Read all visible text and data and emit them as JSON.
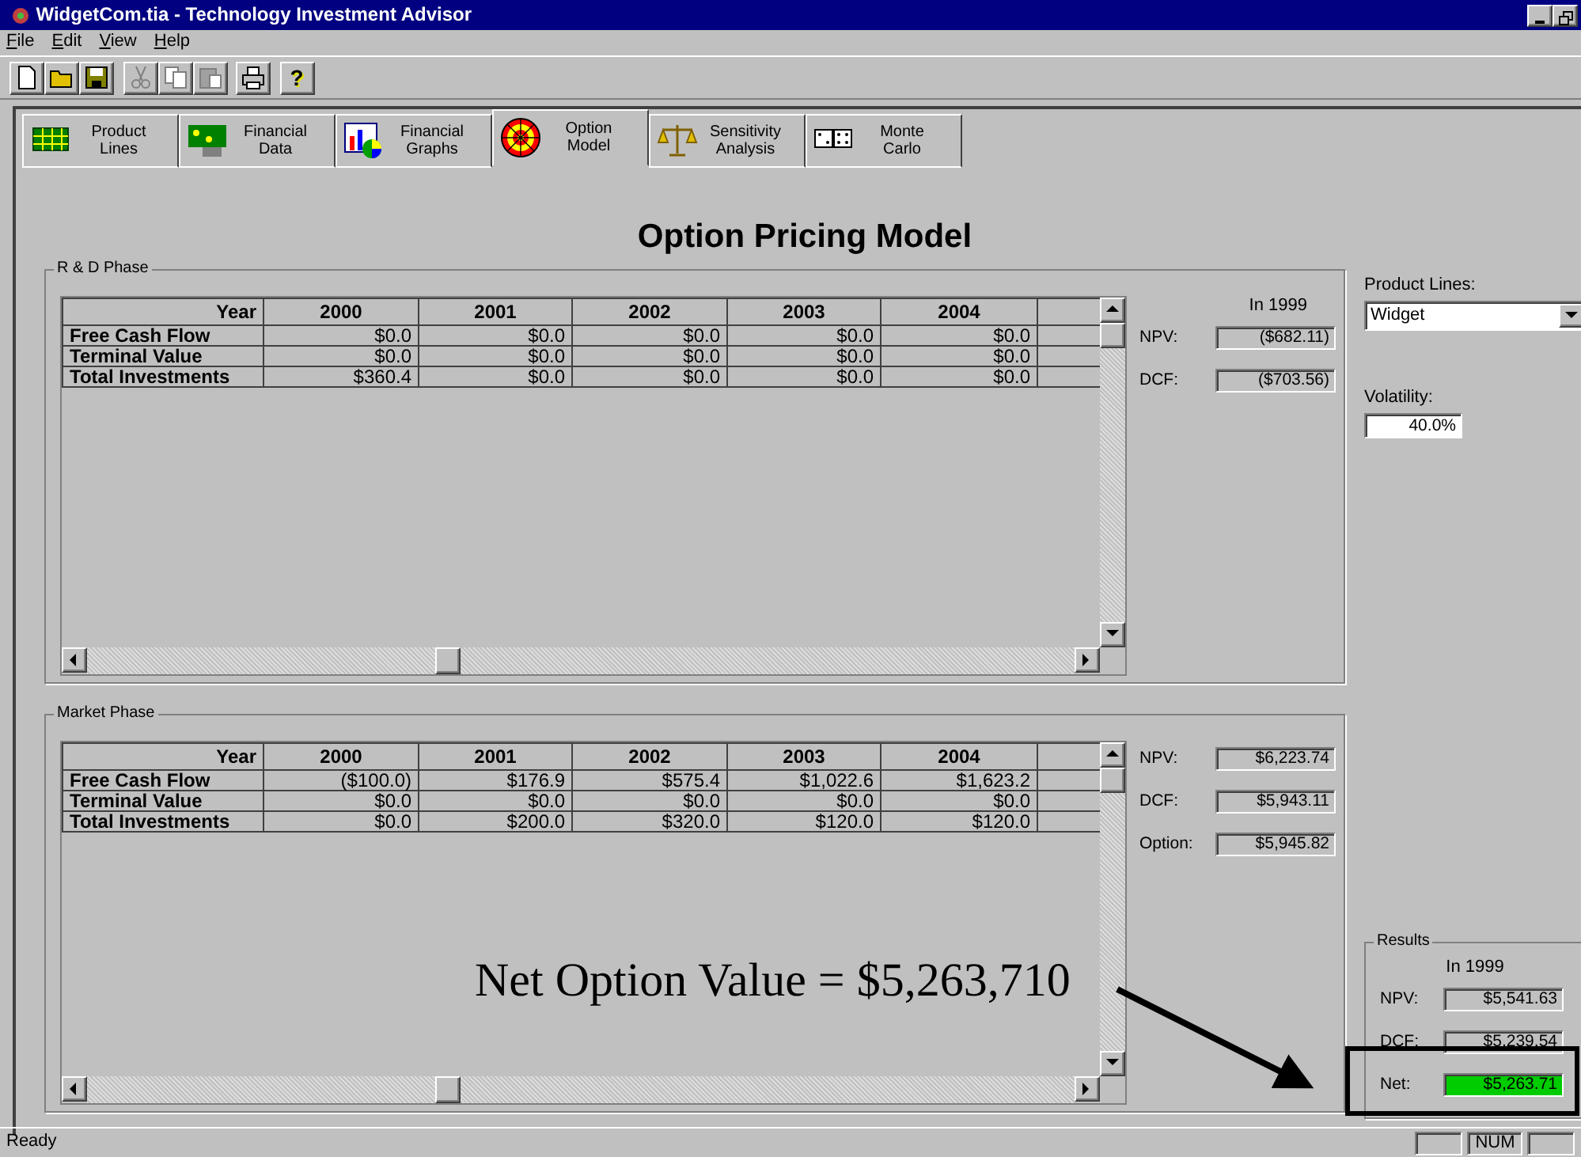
{
  "window": {
    "title": "WidgetCom.tia - Technology Investment Advisor"
  },
  "menu": [
    {
      "label": "File"
    },
    {
      "label": "Edit"
    },
    {
      "label": "View"
    },
    {
      "label": "Help"
    }
  ],
  "toolbar": [
    {
      "kind": "new",
      "disabled": false
    },
    {
      "kind": "open",
      "disabled": false
    },
    {
      "kind": "save",
      "disabled": false
    },
    {
      "kind": "cut",
      "disabled": true
    },
    {
      "kind": "copy",
      "disabled": true
    },
    {
      "kind": "paste",
      "disabled": true
    },
    {
      "kind": "print",
      "disabled": false
    },
    {
      "kind": "help",
      "disabled": false,
      "glyph": "?"
    }
  ],
  "tabs": [
    {
      "kind": "grid",
      "label": "Product Lines",
      "selected": false
    },
    {
      "kind": "board",
      "label": "Financial Data",
      "selected": false
    },
    {
      "kind": "chart",
      "label": "Financial Graphs",
      "selected": false
    },
    {
      "kind": "target",
      "label": "Option Model",
      "selected": true
    },
    {
      "kind": "scale",
      "label": "Sensitivity Analysis",
      "selected": false
    },
    {
      "kind": "dice",
      "label": "Monte Carlo",
      "selected": false
    }
  ],
  "heading": "Option Pricing Model",
  "phases": [
    {
      "title": "R & D Phase",
      "columns": [
        "Year",
        "2000",
        "2001",
        "2002",
        "2003",
        "2004"
      ],
      "rows": [
        {
          "label": "Free Cash Flow",
          "values": [
            "$0.0",
            "$0.0",
            "$0.0",
            "$0.0",
            "$0.0"
          ]
        },
        {
          "label": "Terminal Value",
          "values": [
            "$0.0",
            "$0.0",
            "$0.0",
            "$0.0",
            "$0.0"
          ]
        },
        {
          "label": "Total Investments",
          "values": [
            "$360.4",
            "$0.0",
            "$0.0",
            "$0.0",
            "$0.0"
          ]
        }
      ],
      "caption": "In 1999",
      "metrics": [
        {
          "label": "NPV:",
          "value": "($682.11)"
        },
        {
          "label": "DCF:",
          "value": "($703.56)"
        }
      ]
    },
    {
      "title": "Market Phase",
      "columns": [
        "Year",
        "2000",
        "2001",
        "2002",
        "2003",
        "2004"
      ],
      "rows": [
        {
          "label": "Free Cash Flow",
          "values": [
            "($100.0)",
            "$176.9",
            "$575.4",
            "$1,022.6",
            "$1,623.2"
          ]
        },
        {
          "label": "Terminal Value",
          "values": [
            "$0.0",
            "$0.0",
            "$0.0",
            "$0.0",
            "$0.0"
          ]
        },
        {
          "label": "Total Investments",
          "values": [
            "$0.0",
            "$200.0",
            "$320.0",
            "$120.0",
            "$120.0"
          ]
        }
      ],
      "metrics": [
        {
          "label": "NPV:",
          "value": "$6,223.74"
        },
        {
          "label": "DCF:",
          "value": "$5,943.11"
        },
        {
          "label": "Option:",
          "value": "$5,945.82"
        }
      ]
    }
  ],
  "product_lines": {
    "label": "Product Lines:",
    "value": "Widget"
  },
  "volatility": {
    "label": "Volatility:",
    "value": "40.0%"
  },
  "results": {
    "title": "Results",
    "caption": "In 1999",
    "metrics": [
      {
        "label": "NPV:",
        "value": "$5,541.63",
        "highlighted": false
      },
      {
        "label": "DCF:",
        "value": "$5,239.54",
        "highlighted": false
      },
      {
        "label": "Net:",
        "value": "$5,263.71",
        "highlighted": true
      }
    ]
  },
  "annotation": {
    "text": "Net Option Value = $5,263,710"
  },
  "status_bar": {
    "text": "Ready",
    "panes": [
      {
        "kind": "blank"
      },
      {
        "kind": "text",
        "label": "NUM"
      },
      {
        "kind": "blank"
      }
    ]
  }
}
